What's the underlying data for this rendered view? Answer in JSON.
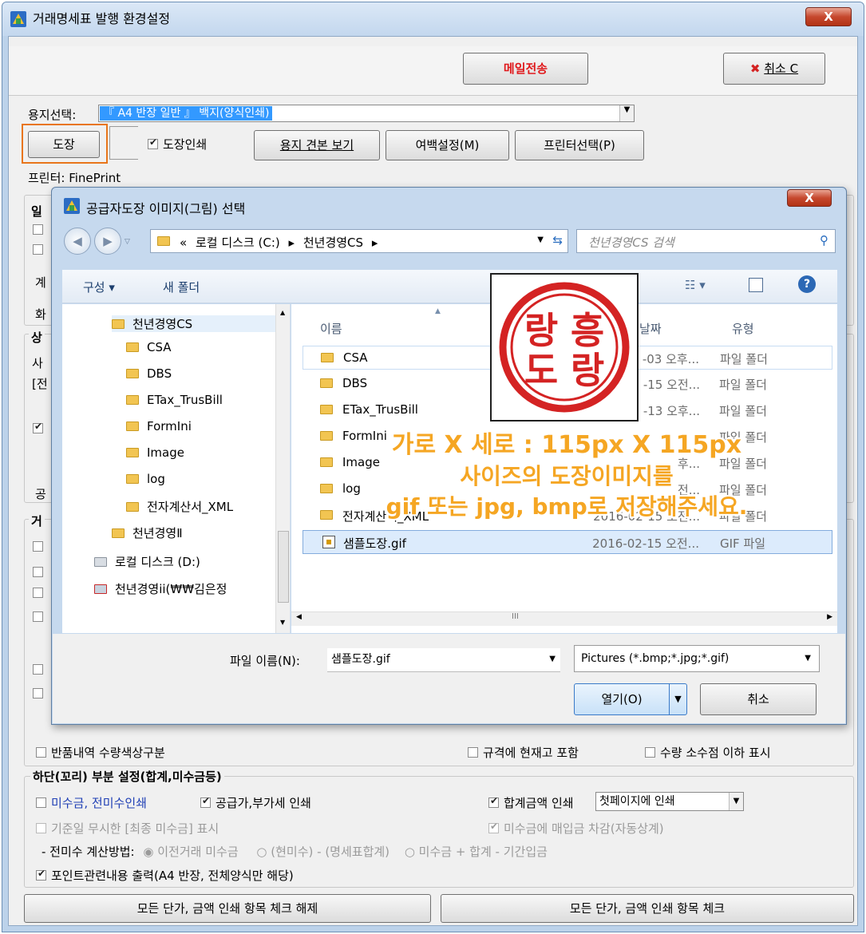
{
  "window": {
    "title": "거래명세표 발행 환경설정",
    "close_glyph": "X"
  },
  "top_buttons": {
    "send_mail": "메일전송",
    "cancel": "취소 C"
  },
  "paper": {
    "label": "용지선택:",
    "value": "『 A4 반장 일반 』 백지(양식인쇄)"
  },
  "row2": {
    "stamp_button": "도장",
    "stamp_print_label": "도장인쇄",
    "preview_button": "용지 견본 보기",
    "margin_button": "여백설정(M)",
    "printer_button": "프린터선택(P)"
  },
  "printer_line": "프린터: FinePrint",
  "left_hidden_rows": [
    "일",
    "계",
    "화",
    "상",
    "사",
    "[전",
    "공",
    "거"
  ],
  "options": {
    "return_qty_color": "반품내역 수량색상구분",
    "include_stock": "규격에 현재고 포함",
    "qty_decimal": "수량 소수점 이하 표시"
  },
  "footer_group": {
    "title": "하단(꼬리) 부분 설정(합계,미수금등)",
    "unpaid_print": "미수금, 전미수인쇄",
    "supply_vat_print": "공급가,부가세 인쇄",
    "total_amount_print": "합계금액 인쇄",
    "total_amount_option": "첫페이지에 인쇄",
    "final_unpaid": "기준일 무시한 [최종 미수금] 표시",
    "deduct_purchase": "미수금에 매입금 차감(자동상계)",
    "calc_label": "- 전미수 계산방법:",
    "calc_opt1": "이전거래 미수금",
    "calc_opt2": "(현미수) - (명세표합계)",
    "calc_opt3": "미수금 + 합계 - 기간입금",
    "points_print": "포인트관련내용 출력(A4 반장, 전체양식만 해당)"
  },
  "bottom_buttons": {
    "uncheck_all": "모든 단가, 금액 인쇄 항목 체크 해제",
    "check_all": "모든 단가, 금액 인쇄 항목 체크"
  },
  "dialog": {
    "title": "공급자도장 이미지(그림) 선택",
    "close_glyph": "X",
    "breadcrumb": [
      "«",
      "로컬 디스크 (C:)",
      "천년경영CS"
    ],
    "search_placeholder": "천년경영CS 검색",
    "toolbar": {
      "organize": "구성 ▾",
      "new_folder": "새 폴더"
    },
    "tree": [
      {
        "label": "천년경영CS",
        "indent": 1
      },
      {
        "label": "CSA",
        "indent": 2
      },
      {
        "label": "DBS",
        "indent": 2
      },
      {
        "label": "ETax_TrusBill",
        "indent": 2
      },
      {
        "label": "FormIni",
        "indent": 2
      },
      {
        "label": "Image",
        "indent": 2
      },
      {
        "label": "log",
        "indent": 2
      },
      {
        "label": "전자계산서_XML",
        "indent": 2
      },
      {
        "label": "천년경영Ⅱ",
        "indent": 1
      },
      {
        "label": "로컬 디스크 (D:)",
        "indent": 0
      },
      {
        "label": "천년경영ii(₩₩김은정",
        "indent": 0
      }
    ],
    "columns": {
      "name": "이름",
      "date": "날짜",
      "type": "유형"
    },
    "files": [
      {
        "name": "CSA",
        "date": "-03 오후...",
        "type": "파일 폴더"
      },
      {
        "name": "DBS",
        "date": "-15 오전...",
        "type": "파일 폴더"
      },
      {
        "name": "ETax_TrusBill",
        "date": "-13 오후...",
        "type": "파일 폴더"
      },
      {
        "name": "FormIni",
        "date": "",
        "type": "파일 폴더"
      },
      {
        "name": "Image",
        "date": "후...",
        "type": "파일 폴더"
      },
      {
        "name": "log",
        "date": "전...",
        "type": "파일 폴더"
      },
      {
        "name": "전자계산서_XML",
        "date": "2016-02-15 오전...",
        "type": "파일 폴더"
      },
      {
        "name": "샘플도장.gif",
        "date": "2016-02-15 오전...",
        "type": "GIF 파일"
      }
    ],
    "filename_label": "파일 이름(N):",
    "filename_value": "샘플도장.gif",
    "filter_value": "Pictures (*.bmp;*.jpg;*.gif)",
    "open_button": "열기(O)",
    "cancel_button": "취소",
    "scroll_mark": "III"
  },
  "overlay": {
    "line1": "가로 X 세로 : 115px X 115px",
    "line2": "사이즈의 도장이미지를",
    "line3": "gif 또는 jpg, bmp로 저장해주세요."
  },
  "stamp_chars": [
    "랑",
    "흥",
    "도",
    "랑"
  ],
  "colors": {
    "send_mail_text": "#e0191c",
    "highlight_orange": "#e8751a",
    "selected_blue": "#3399ff",
    "stamp_red": "#d42323",
    "overlay_orange": "#f5a623",
    "link_blue": "#1f3fb5"
  }
}
